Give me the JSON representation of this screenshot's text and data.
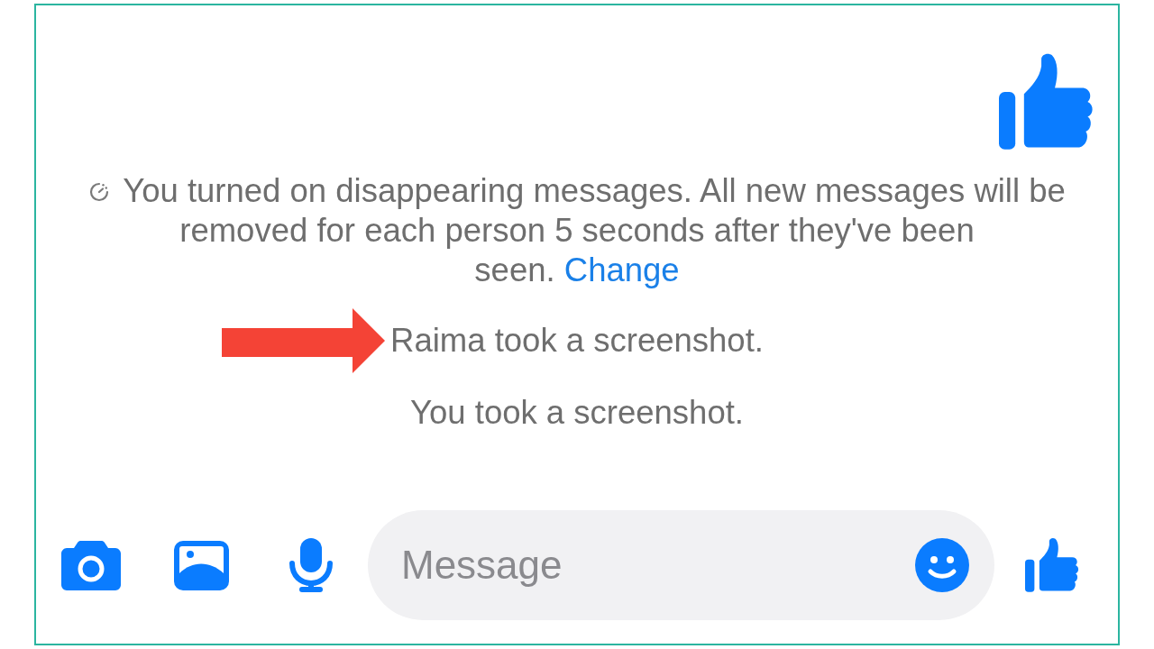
{
  "notices": [
    {
      "kind": "disappearing",
      "text": "You turned on disappearing messages. All new messages will be removed for each person 5 seconds after they've been seen.",
      "link": "Change"
    },
    {
      "kind": "screenshot",
      "text": "Raima took a screenshot.",
      "annotated": true
    },
    {
      "kind": "screenshot",
      "text": "You took a screenshot.",
      "annotated": false
    }
  ],
  "composer": {
    "placeholder": "Message"
  }
}
